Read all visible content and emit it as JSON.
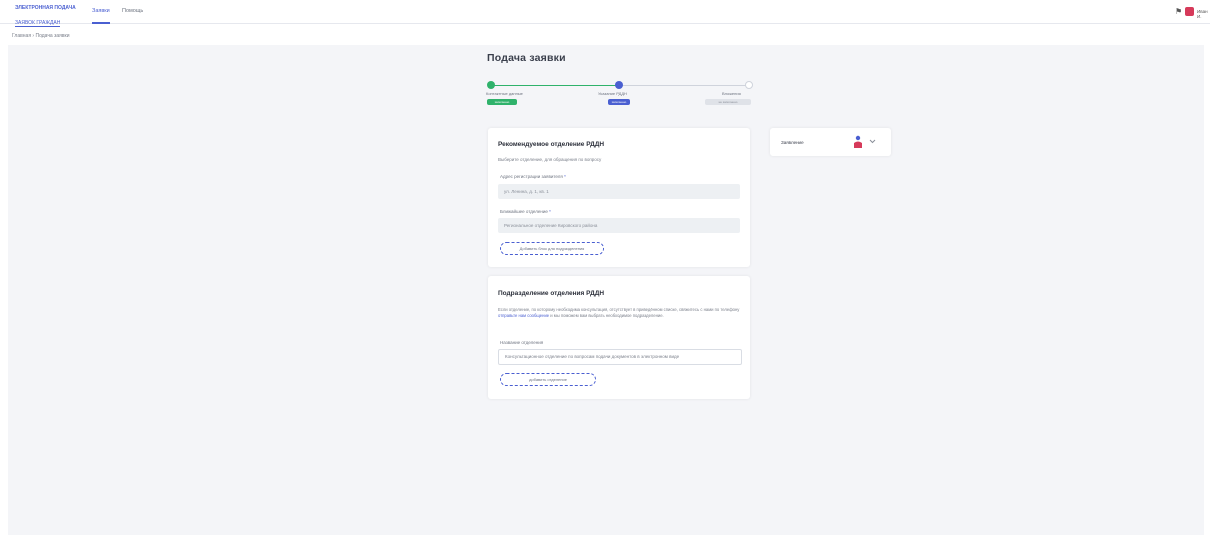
{
  "header": {
    "logo_line1": "ЭЛЕКТРОННАЯ ПОДАЧА",
    "logo_line2": "ЗАЯВОК ГРАЖДАН",
    "nav": [
      {
        "label": "Заявки",
        "active": true
      },
      {
        "label": "Помощь",
        "active": false
      }
    ],
    "user_name": "Иван И."
  },
  "breadcrumb": "Главная › Подача заявки",
  "page_title": "Подача заявки",
  "stepper": {
    "steps": [
      {
        "label": "Контактные данные",
        "badge": "заполнено",
        "status": "done"
      },
      {
        "label": "Указание РДДН",
        "badge": "заполнено",
        "status": "current"
      },
      {
        "label": "Вложения",
        "badge": "не заполнено",
        "status": "pending"
      }
    ]
  },
  "card1": {
    "title": "Рекомендуемое отделение РДДН",
    "subtitle": "Выберите отделение, для обращения по вопросу",
    "field1_label": "Адрес регистрации заявителя",
    "field1_value": "ул. Ленина, д. 1, кв. 1",
    "field2_label": "Ближайшее отделение",
    "field2_value": "Региональное отделение Кировского района",
    "add_button": "Добавить блок для подразделения"
  },
  "card2": {
    "title": "Подразделение отделения РДДН",
    "desc_pre": "Если отделение, по которому необходима консультация, отсутствует в приведённом списке, свяжитесь с нами по телефону",
    "desc_link": "отправьте нам сообщение",
    "desc_post": "и мы поможем вам выбрать необходимое подразделение.",
    "field_label": "Название отделения",
    "field_value": "Консультационное отделение по вопросам подачи документов в электронном виде",
    "add_button": "добавить отделение"
  },
  "side_card": {
    "label": "Заявление"
  },
  "colors": {
    "accent": "#4a5fd1",
    "done": "#2fb26b",
    "pending": "#dfe2e8"
  }
}
